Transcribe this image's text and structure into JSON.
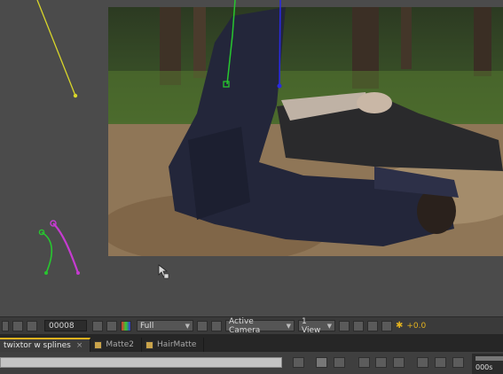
{
  "viewer": {
    "frame_field": "00008",
    "resolution": "Full",
    "camera": "Active Camera",
    "view_layout": "1 View",
    "exposure": "+0.0"
  },
  "tabs": [
    {
      "label": "twixtor w splines",
      "active": true,
      "color": "#c9a34a"
    },
    {
      "label": "Matte2",
      "active": false,
      "color": "#c9a34a"
    },
    {
      "label": "HairMatte",
      "active": false,
      "color": "#c9a34a"
    }
  ],
  "timeline": {
    "ruler_label": "000s"
  },
  "colors": {
    "spline_yellow": "#d8d62a",
    "spline_green": "#27c62f",
    "spline_magenta": "#c53bd0",
    "spline_blue": "#2a2ae0",
    "accent": "#e3b21f"
  },
  "icons": [
    "camera-icon",
    "grid-icon",
    "color-icon",
    "safe-zone-icon",
    "fast-preview-icon",
    "3d-view-icon",
    "comp-flowchart-icon"
  ]
}
